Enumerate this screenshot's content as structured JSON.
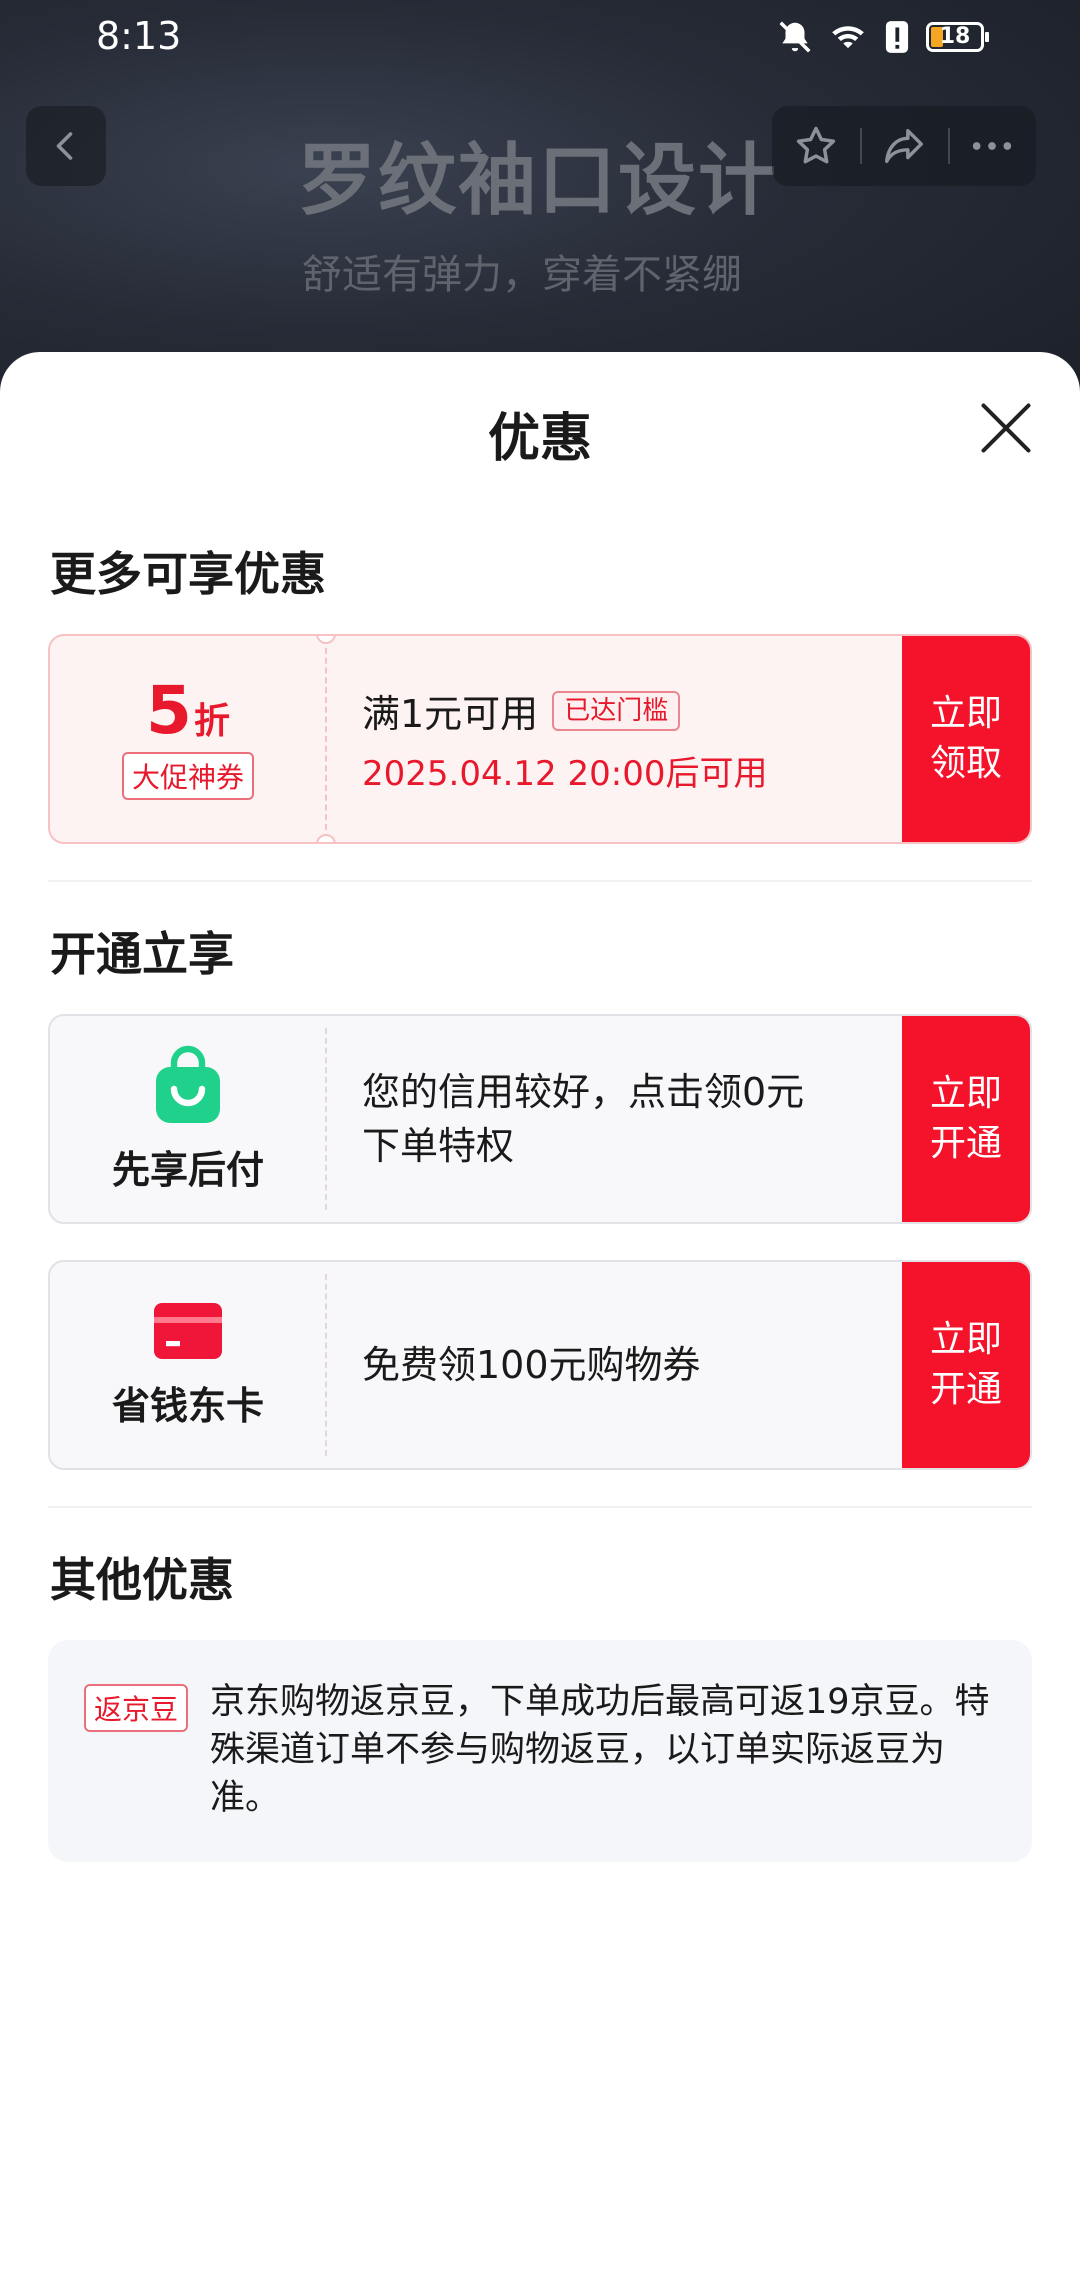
{
  "status_bar": {
    "time": "8:13",
    "battery": "18"
  },
  "background": {
    "title": "罗纹袖口设计",
    "subtitle": "舒适有弹力，穿着不紧绷"
  },
  "sheet": {
    "title": "优惠",
    "sections": {
      "more": "更多可享优惠",
      "open": "开通立享",
      "other": "其他优惠"
    }
  },
  "coupon": {
    "discount_value": "5",
    "discount_unit": "折",
    "tag": "大促神券",
    "condition": "满1元可用",
    "threshold_tag": "已达门槛",
    "available_time": "2025.04.12 20:00后可用",
    "action": "立即领取"
  },
  "services": [
    {
      "name": "先享后付",
      "desc_line1": "您的信用较好，点击领0元",
      "desc_line2": "下单特权",
      "action": "立即开通"
    },
    {
      "name": "省钱东卡",
      "desc_line1": "免费领100元购物券",
      "desc_line2": "",
      "action": "立即开通"
    }
  ],
  "other": {
    "tag": "返京豆",
    "text": "京东购物返京豆，下单成功后最高可返19京豆。特殊渠道订单不参与购物返豆，以订单实际返豆为准。"
  },
  "colors": {
    "accent": "#f5132b",
    "accent_text": "#e8192c",
    "green": "#1fd18a"
  },
  "icons": {
    "back": "chevron-left-icon",
    "favorite": "star-icon",
    "share": "share-icon",
    "more": "more-icon",
    "close": "close-icon",
    "bag": "shopping-bag-icon",
    "card": "credit-card-icon"
  }
}
